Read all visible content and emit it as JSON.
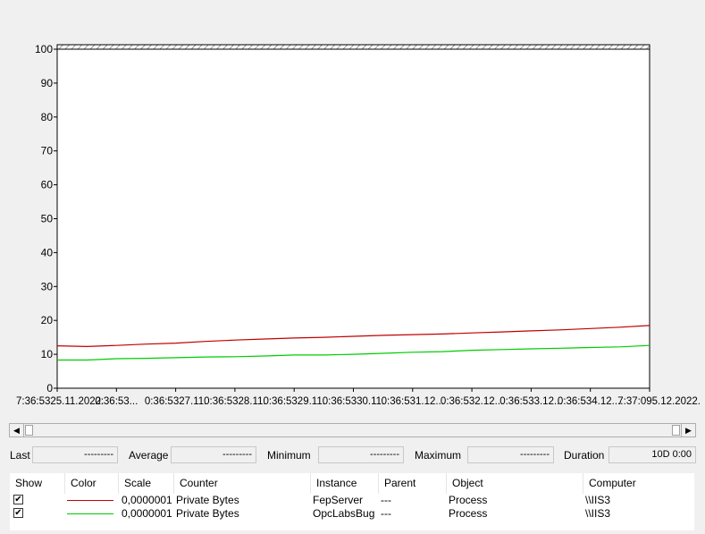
{
  "chart_data": {
    "type": "line",
    "ylim": [
      0,
      100
    ],
    "yticks": [
      0,
      10,
      20,
      30,
      40,
      50,
      60,
      70,
      80,
      90,
      100
    ],
    "xtick_labels": [
      "7:36:5325.11.2022.",
      "0:36:53...",
      "0:36:5327.11.",
      "0:36:5328.11.",
      "0:36:5329.11.",
      "0:36:5330.11.",
      "0:36:531.12...",
      "0:36:532.12...",
      "0:36:533.12...",
      "0:36:534.12....",
      "7:37:095.12.2022."
    ],
    "x": [
      0,
      0.5,
      1,
      1.5,
      2,
      2.5,
      3,
      3.5,
      4,
      4.5,
      5,
      5.5,
      6,
      6.5,
      7,
      7.5,
      8,
      8.5,
      9,
      9.5,
      10
    ],
    "series": [
      {
        "color": "#c00000",
        "values": [
          12.5,
          12.3,
          12.6,
          13.0,
          13.3,
          13.8,
          14.2,
          14.5,
          14.8,
          15.0,
          15.3,
          15.6,
          15.8,
          16.0,
          16.3,
          16.6,
          16.9,
          17.2,
          17.6,
          18.0,
          18.5
        ]
      },
      {
        "color": "#00cc00",
        "values": [
          8.3,
          8.3,
          8.7,
          8.8,
          9.0,
          9.2,
          9.3,
          9.5,
          9.8,
          9.8,
          10.0,
          10.3,
          10.6,
          10.8,
          11.2,
          11.4,
          11.6,
          11.8,
          12.0,
          12.2,
          12.6
        ]
      }
    ]
  },
  "stats": {
    "last_label": "Last",
    "last_value": "---------",
    "average_label": "Average",
    "average_value": "---------",
    "minimum_label": "Minimum",
    "minimum_value": "---------",
    "maximum_label": "Maximum",
    "maximum_value": "---------",
    "duration_label": "Duration",
    "duration_value": "10D 0:00"
  },
  "table": {
    "headers": [
      "Show",
      "Color",
      "Scale",
      "Counter",
      "Instance",
      "Parent",
      "Object",
      "Computer"
    ],
    "rows": [
      {
        "show": "✔",
        "color": "#c00000",
        "scale": "0,0000001",
        "counter": "Private Bytes",
        "instance": "FepServer",
        "parent": "---",
        "object": "Process",
        "computer": "\\\\IIS3"
      },
      {
        "show": "✔",
        "color": "#00cc00",
        "scale": "0,0000001",
        "counter": "Private Bytes",
        "instance": "OpcLabsBug",
        "parent": "---",
        "object": "Process",
        "computer": "\\\\IIS3"
      }
    ]
  },
  "scrollbar": {
    "left_arrow": "◀",
    "right_arrow": "▶"
  }
}
